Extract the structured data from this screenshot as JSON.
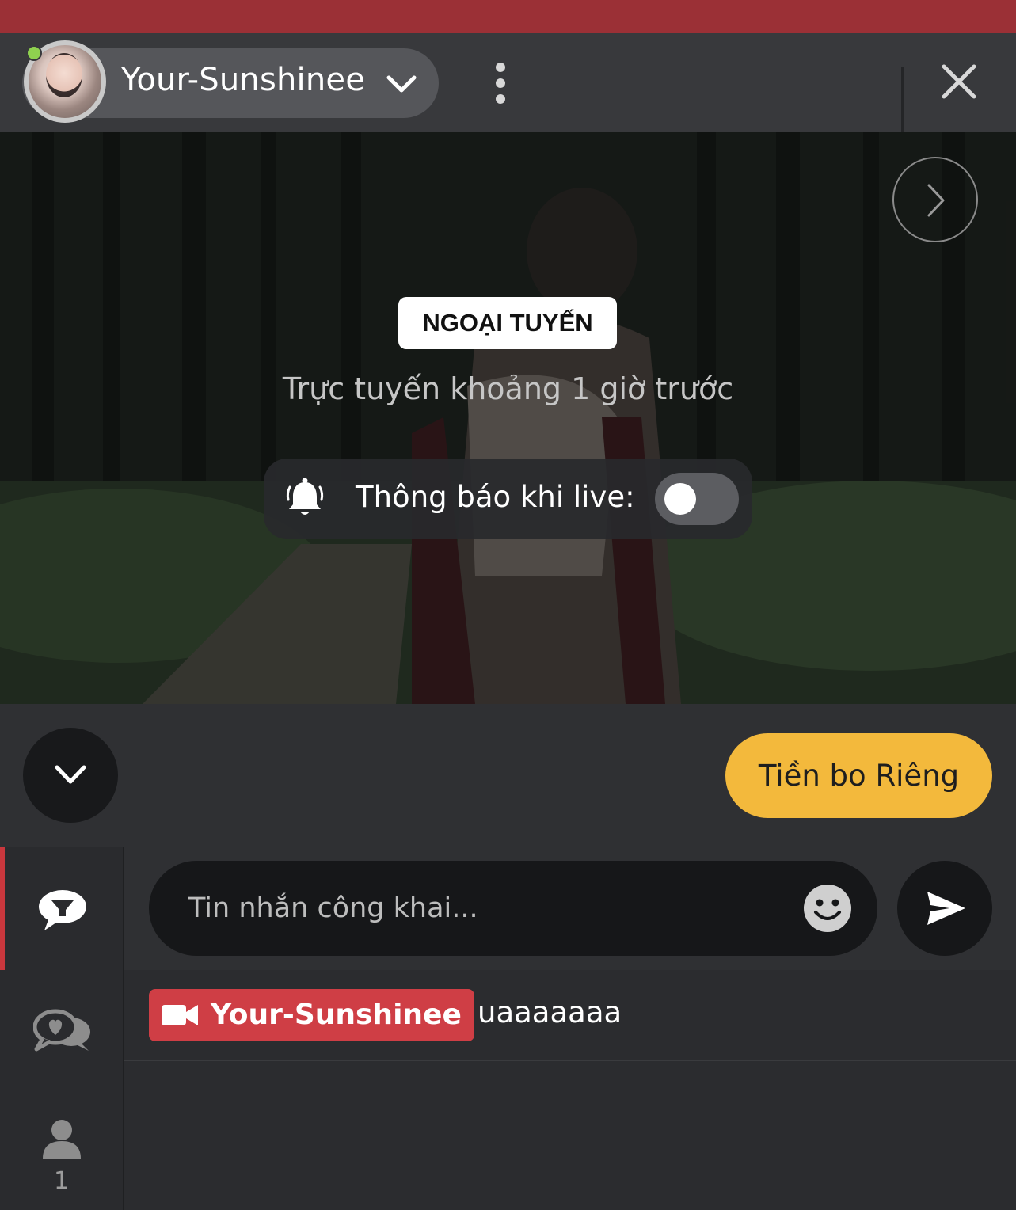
{
  "header": {
    "username": "Your-Sunshinee",
    "avatar_icon": "avatar-photo",
    "status_color": "#8fd14f",
    "menu_icon": "kebab-icon",
    "close_icon": "close-icon"
  },
  "stream": {
    "status_badge": "NGOẠI TUYẾN",
    "last_online": "Trực tuyến khoảng 1 giờ trước",
    "notify_label": "Thông báo khi live:",
    "notify_enabled": false,
    "next_icon": "chevron-right-icon"
  },
  "controls": {
    "tip_label": "Tiền bo Riêng",
    "tip_color": "#f3b93c",
    "collapse_icon": "chevron-down-icon"
  },
  "sidebar": {
    "tabs": [
      {
        "icon": "public-chat-icon",
        "active": true
      },
      {
        "icon": "private-chat-icon",
        "active": false
      },
      {
        "icon": "viewers-icon",
        "active": false,
        "count": "1"
      }
    ]
  },
  "composer": {
    "placeholder": "Tin nhắn công khai...",
    "emoji_icon": "smiley-icon",
    "send_icon": "send-icon"
  },
  "chat": {
    "messages": [
      {
        "user": "Your-Sunshinee",
        "role_icon": "camera-icon",
        "text": "uaaaaaaa"
      }
    ]
  }
}
